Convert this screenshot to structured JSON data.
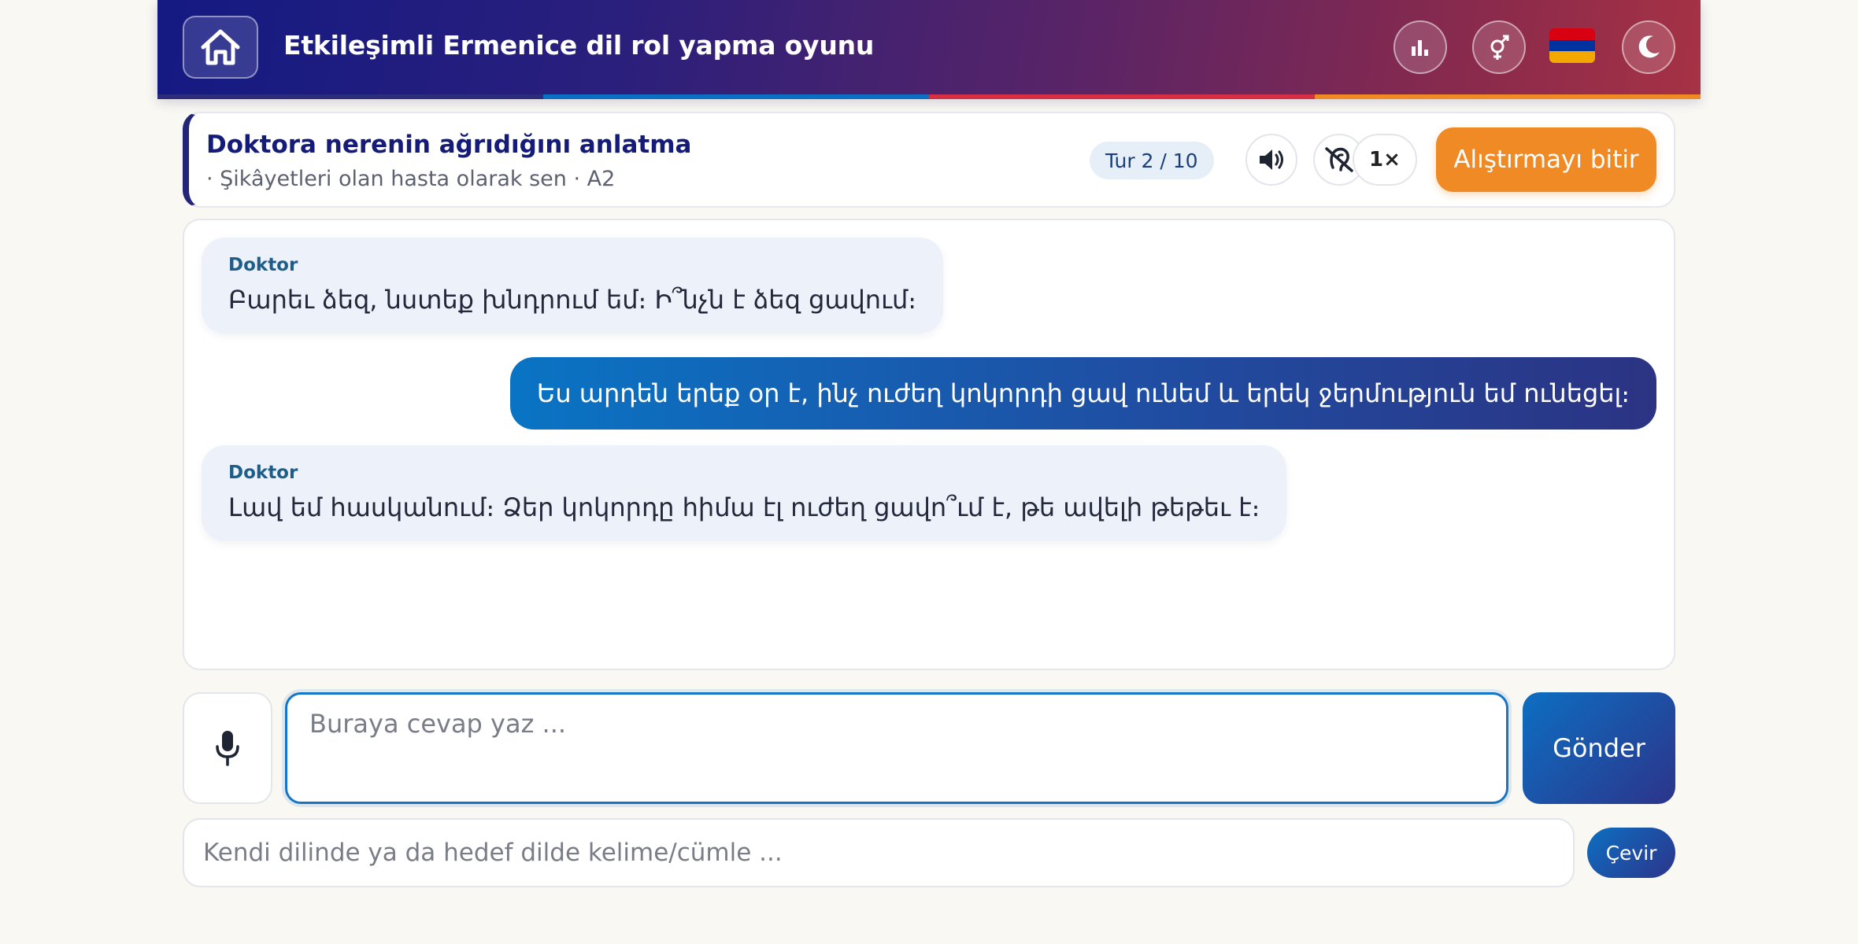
{
  "header": {
    "title": "Etkileşimli Ermenice dil rol yapma oyunu",
    "icons": [
      "home-icon",
      "stats-icon",
      "gender-icon",
      "armenia-flag",
      "moon-icon"
    ],
    "stripe_colors": [
      "#2b2d7c",
      "#0b6fc4",
      "#d62e45",
      "#f08a24"
    ]
  },
  "scenario": {
    "title": "Doktora nerenin ağrıdığını anlatma",
    "subtitle": "· Şikâyetleri olan hasta olarak sen · A2",
    "turn": "Tur 2 / 10",
    "speed": "1×",
    "finish_label": "Alıştırmayı bitir"
  },
  "chat": {
    "messages": [
      {
        "role": "assistant",
        "speaker": "Doktor",
        "text": "Բարեւ ձեզ, նստեք խնդրում եմ։ Ի՞նչն է ձեզ ցավում։"
      },
      {
        "role": "user",
        "text": "Ես արդեն երեք օր է, ինչ ուժեղ կոկորդի ցավ ունեմ և երեկ ջերմություն եմ ունեցել։"
      },
      {
        "role": "assistant",
        "speaker": "Doktor",
        "text": "Լավ եմ հասկանում։ Ձեր կոկորդը հիմա էլ ուժեղ ցավո՞ւմ է, թե ավելի թեթեւ է։"
      }
    ]
  },
  "input": {
    "placeholder": "Buraya cevap yaz ...",
    "value": "",
    "send_label": "Gönder"
  },
  "translate": {
    "placeholder": "Kendi dilinde ya da hedef dilde kelime/cümle ...",
    "button_label": "Çevir"
  },
  "colors": {
    "accent": "#1576c6",
    "brand_dark": "#151b78",
    "finish": "#f08a24",
    "flag": [
      "#d90012",
      "#0033a0",
      "#f2a800"
    ]
  }
}
